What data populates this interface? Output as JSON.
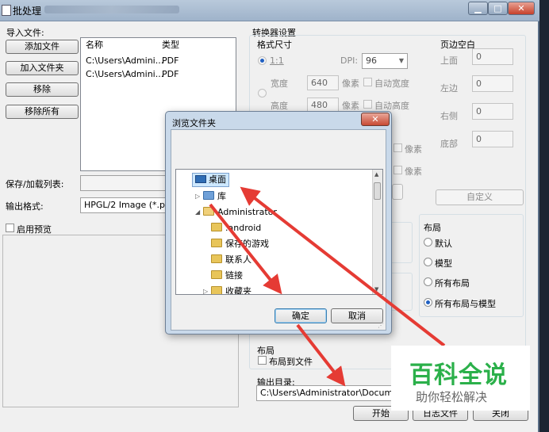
{
  "window": {
    "title": "批处理",
    "min_glyph": "▁",
    "max_glyph": "□",
    "close_glyph": "✕"
  },
  "import": {
    "label": "导入文件:",
    "add_file": "添加文件",
    "add_folder": "加入文件夹",
    "remove": "移除",
    "remove_all": "移除所有"
  },
  "filelist": {
    "columns": [
      "名称",
      "类型"
    ],
    "rows": [
      {
        "name": "C:\\Users\\Admini...",
        "type": "PDF"
      },
      {
        "name": "C:\\Users\\Admini...",
        "type": "PDF"
      }
    ]
  },
  "save_load_label": "保存/加载列表:",
  "output_format": {
    "label": "输出格式:",
    "value": "HPGL/2 Image (*.plt)"
  },
  "preview_label": "启用预览",
  "converter": {
    "title": "转换器设置",
    "format_size": "格式尺寸",
    "ratio": "1:1",
    "dpi_label": "DPI:",
    "dpi_value": "96",
    "width_label": "宽度",
    "width_value": "640",
    "height_label": "高度",
    "height_value": "480",
    "pixel": "像素",
    "auto_width": "自动宽度",
    "auto_height": "自动高度"
  },
  "margins": {
    "title": "页边空白",
    "top": "上面",
    "top_value": "0",
    "left": "左边",
    "left_value": "0",
    "right": "右侧",
    "right_value": "0",
    "bottom": "底部",
    "bottom_value": "0",
    "custom": "自定义"
  },
  "layout_group": {
    "title": "布局",
    "options": [
      "默认",
      "模型",
      "所有布局",
      "所有布局与模型"
    ],
    "selected": "所有布局与模型"
  },
  "layout_file": {
    "title": "布局",
    "checkbox": "布局到文件"
  },
  "output_dir": {
    "label": "输出目录:",
    "value": "C:\\Users\\Administrator\\Documents"
  },
  "bottom_buttons": {
    "start": "开始",
    "log": "日志文件",
    "close": "关闭"
  },
  "dialog": {
    "title": "浏览文件夹",
    "close_glyph": "✕",
    "tree": [
      {
        "label": "桌面",
        "selected": true
      },
      {
        "label": "库"
      },
      {
        "label": "Administrator"
      },
      {
        "label": ".android"
      },
      {
        "label": "保存的游戏"
      },
      {
        "label": "联系人"
      },
      {
        "label": "链接"
      },
      {
        "label": "收藏夹"
      }
    ],
    "ok": "确定",
    "cancel": "取消"
  },
  "watermark": {
    "title": "百科全说",
    "subtitle": "助你轻松解决"
  },
  "colors": {
    "arrow": "#e53b34",
    "watermark_green": "#2bb04a",
    "accent_selected": "#cde8ff"
  }
}
